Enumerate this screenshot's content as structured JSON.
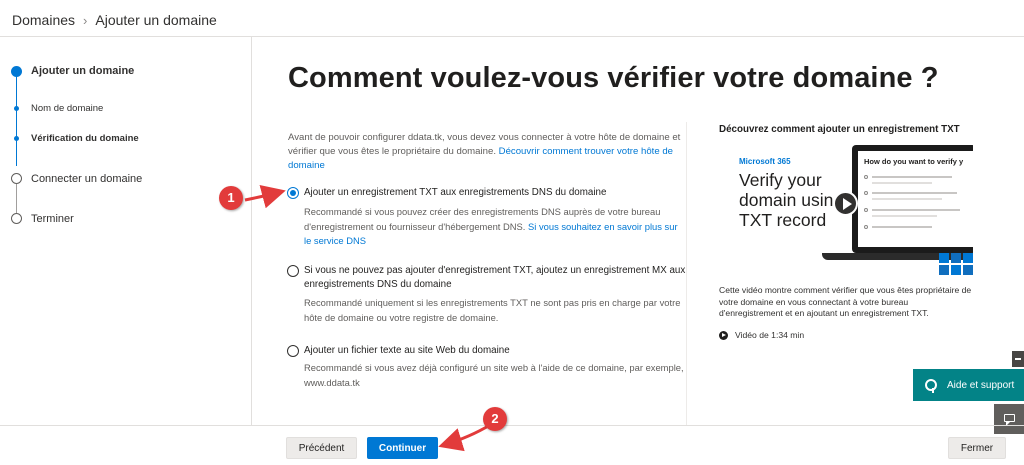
{
  "breadcrumb": {
    "root": "Domaines",
    "current": "Ajouter un domaine"
  },
  "stepper": {
    "steps": [
      {
        "label": "Ajouter un domaine",
        "state": "active"
      },
      {
        "label": "Nom de domaine",
        "state": "done"
      },
      {
        "label": "Vérification du domaine",
        "state": "active"
      },
      {
        "label": "Connecter un domaine",
        "state": "pending"
      },
      {
        "label": "Terminer",
        "state": "pending"
      }
    ]
  },
  "main": {
    "title": "Comment voulez-vous vérifier votre domaine ?",
    "intro": "Avant de pouvoir configurer ddata.tk, vous devez vous connecter à votre hôte de domaine et vérifier que vous êtes le propriétaire du domaine. ",
    "intro_link": "Découvrir comment trouver votre hôte de domaine",
    "options": [
      {
        "title": "Ajouter un enregistrement TXT aux enregistrements DNS du domaine",
        "desc": "Recommandé si vous pouvez créer des enregistrements DNS auprès de votre bureau d'enregistrement ou fournisseur d'hébergement DNS. ",
        "link": "Si vous souhaitez en savoir plus sur le service DNS",
        "selected": true
      },
      {
        "title": "Si vous ne pouvez pas ajouter d'enregistrement TXT, ajoutez un enregistrement MX aux enregistrements DNS du domaine",
        "desc": "Recommandé uniquement si les enregistrements TXT ne sont pas pris en charge par votre hôte de domaine ou votre registre de domaine.",
        "selected": false
      },
      {
        "title": "Ajouter un fichier texte au site Web du domaine",
        "desc": "Recommandé si vous avez déjà configuré un site web à l'aide de ce domaine, par exemple, www.ddata.tk",
        "selected": false
      }
    ]
  },
  "video": {
    "heading": "Découvrez comment ajouter un enregistrement TXT",
    "thumb_brand": "Microsoft 365",
    "thumb_title": "Verify your domain using a TXT record",
    "thumb_screen_heading": "How do you want to verify y",
    "description": "Cette vidéo montre comment vérifier que vous êtes propriétaire de votre domaine en vous connectant à votre bureau d'enregistrement et en ajoutant un enregistrement TXT.",
    "duration": "Vidéo de 1:34 min"
  },
  "footer": {
    "prev": "Précédent",
    "next": "Continuer",
    "close": "Fermer"
  },
  "help": {
    "label": "Aide et support"
  },
  "annotations": [
    "1",
    "2"
  ],
  "colors": {
    "accent": "#0078d4",
    "help": "#038387",
    "annotation": "#e23b3b"
  }
}
